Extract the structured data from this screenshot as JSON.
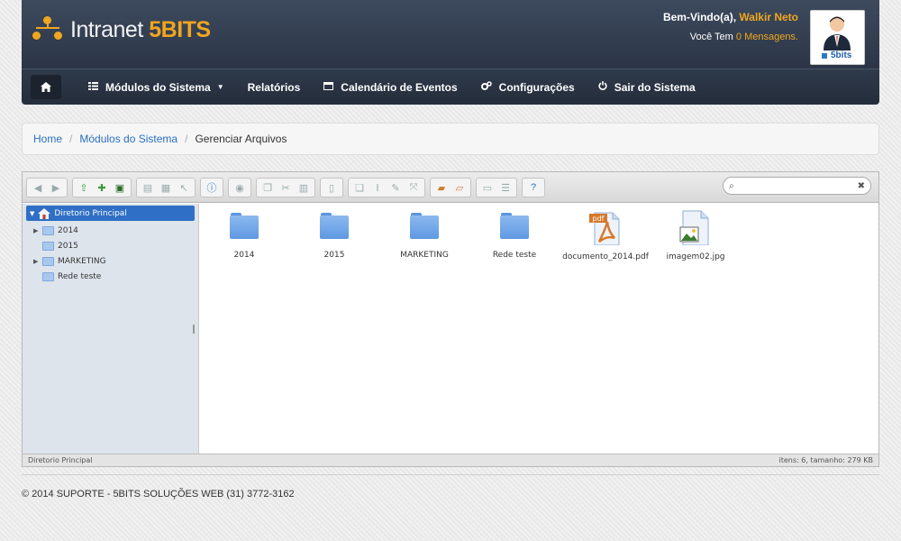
{
  "header": {
    "logo_text_main": "Intranet ",
    "logo_text_accent": "5BITS",
    "welcome_prefix": "Bem-Vindo(a), ",
    "user_name": "Walkir Neto",
    "messages_prefix": "Você Tem ",
    "messages_count": "0 Mensagens.",
    "avatar_brand": "5bits",
    "accent_color": "#f0a61e"
  },
  "nav": {
    "items": [
      {
        "label": "Módulos do Sistema",
        "icon": "grid-icon"
      },
      {
        "label": "Relatórios",
        "icon": ""
      },
      {
        "label": "Calendário de Eventos",
        "icon": "calendar-icon"
      },
      {
        "label": "Configurações",
        "icon": "gears-icon"
      },
      {
        "label": "Sair do Sistema",
        "icon": "power-icon"
      }
    ]
  },
  "breadcrumb": {
    "home": "Home",
    "modules": "Módulos do Sistema",
    "current": "Gerenciar Arquivos"
  },
  "filemanager": {
    "search_placeholder": "",
    "tree": {
      "root": "Diretorio Principal",
      "children": [
        {
          "label": "2014",
          "expandable": true
        },
        {
          "label": "2015",
          "expandable": false
        },
        {
          "label": "MARKETING",
          "expandable": true
        },
        {
          "label": "Rede teste",
          "expandable": false
        }
      ]
    },
    "files": [
      {
        "name": "2014",
        "type": "folder"
      },
      {
        "name": "2015",
        "type": "folder"
      },
      {
        "name": "MARKETING",
        "type": "folder"
      },
      {
        "name": "Rede teste",
        "type": "folder"
      },
      {
        "name": "documento_2014.pdf",
        "type": "pdf",
        "badge": "pdf"
      },
      {
        "name": "imagem02.jpg",
        "type": "image"
      }
    ],
    "status_path": "Diretorio Principal",
    "status_info": "itens: 6, tamanho: 279 KB"
  },
  "footer": {
    "text": "© 2014 SUPORTE - 5BITS SOLUÇÕES WEB (31) 3772-3162"
  }
}
